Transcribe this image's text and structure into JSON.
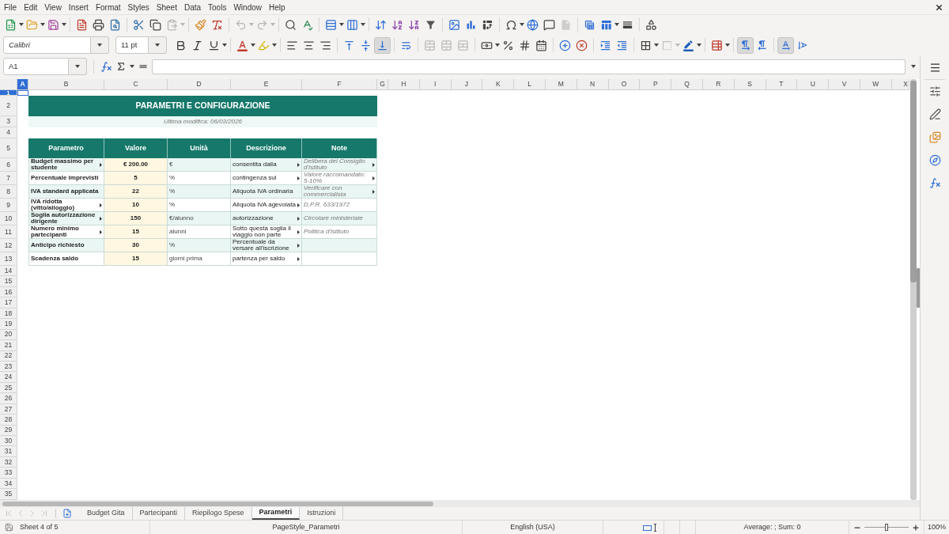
{
  "menu": [
    "File",
    "Edit",
    "View",
    "Insert",
    "Format",
    "Styles",
    "Sheet",
    "Data",
    "Tools",
    "Window",
    "Help"
  ],
  "standard_toolbar": [
    [
      {
        "kind": "new",
        "disabled": false
      },
      {
        "kind": "open",
        "disabled": false
      },
      {
        "kind": "save",
        "disabled": false
      }
    ],
    [
      {
        "kind": "pdf",
        "disabled": false
      },
      {
        "kind": "print",
        "disabled": false
      },
      {
        "kind": "preview",
        "disabled": false
      }
    ],
    [
      {
        "kind": "cut",
        "disabled": false
      },
      {
        "kind": "copy",
        "disabled": false
      },
      {
        "kind": "paste",
        "disabled": true
      }
    ],
    [
      {
        "kind": "clone",
        "disabled": false
      },
      {
        "kind": "clear",
        "disabled": false
      }
    ],
    [
      {
        "kind": "undo",
        "disabled": true
      },
      {
        "kind": "redo",
        "disabled": true
      }
    ],
    [
      {
        "kind": "find",
        "disabled": false
      },
      {
        "kind": "spelling",
        "disabled": false
      }
    ],
    [
      {
        "kind": "rows",
        "disabled": false
      },
      {
        "kind": "columns",
        "disabled": false
      }
    ],
    [
      {
        "kind": "sort",
        "disabled": false
      },
      {
        "kind": "ascending",
        "disabled": false
      },
      {
        "kind": "descending",
        "disabled": false
      },
      {
        "kind": "filter",
        "disabled": false
      }
    ],
    [
      {
        "kind": "image",
        "disabled": false
      },
      {
        "kind": "chart",
        "disabled": false
      },
      {
        "kind": "pivot",
        "disabled": false
      }
    ],
    [
      {
        "kind": "special",
        "disabled": false
      },
      {
        "kind": "hyperlink",
        "disabled": false
      },
      {
        "kind": "comment",
        "disabled": false
      },
      {
        "kind": "header",
        "disabled": true
      }
    ],
    [
      {
        "kind": "printarea",
        "disabled": false
      },
      {
        "kind": "freeze",
        "disabled": false
      },
      {
        "kind": "split",
        "disabled": false
      }
    ],
    [
      {
        "kind": "draw",
        "disabled": false
      }
    ]
  ],
  "formatting_toolbar": {
    "font_name": "Calibri",
    "font_size": "11 pt",
    "groups": [
      [
        {
          "kind": "bold",
          "disabled": false,
          "selected": false
        },
        {
          "kind": "italic",
          "disabled": false,
          "selected": false
        },
        {
          "kind": "underline",
          "disabled": false,
          "selected": false
        }
      ],
      [
        {
          "kind": "fontcolor",
          "disabled": false,
          "selected": false
        },
        {
          "kind": "highlight",
          "disabled": false,
          "selected": false
        }
      ],
      [
        {
          "kind": "left",
          "disabled": false,
          "selected": false
        },
        {
          "kind": "center",
          "disabled": false,
          "selected": false
        },
        {
          "kind": "right",
          "disabled": false,
          "selected": false
        }
      ],
      [
        {
          "kind": "top",
          "disabled": false,
          "selected": false
        },
        {
          "kind": "middle",
          "disabled": false,
          "selected": false
        },
        {
          "kind": "bottom",
          "disabled": false,
          "selected": true
        }
      ],
      [
        {
          "kind": "wrap",
          "disabled": false,
          "selected": false
        }
      ],
      [
        {
          "kind": "mergecenter",
          "disabled": true,
          "selected": false
        },
        {
          "kind": "merge",
          "disabled": true,
          "selected": false
        },
        {
          "kind": "unmerge",
          "disabled": true,
          "selected": false
        }
      ],
      [
        {
          "kind": "currency",
          "disabled": false,
          "selected": false
        },
        {
          "kind": "percent",
          "disabled": false,
          "selected": false
        },
        {
          "kind": "number",
          "disabled": false,
          "selected": false
        },
        {
          "kind": "date",
          "disabled": false,
          "selected": false
        }
      ],
      [
        {
          "kind": "adddecimal",
          "disabled": false,
          "selected": false
        },
        {
          "kind": "deldecimal",
          "disabled": false,
          "selected": false
        }
      ],
      [
        {
          "kind": "indent",
          "disabled": false,
          "selected": false
        },
        {
          "kind": "outdent",
          "disabled": false,
          "selected": false
        }
      ],
      [
        {
          "kind": "borders",
          "disabled": false,
          "selected": false
        },
        {
          "kind": "borderstyle",
          "disabled": true,
          "selected": false
        },
        {
          "kind": "bordercolor",
          "disabled": false,
          "selected": false
        }
      ],
      [
        {
          "kind": "conditional",
          "disabled": false,
          "selected": false
        }
      ],
      [
        {
          "kind": "ltr",
          "disabled": false,
          "selected": true
        },
        {
          "kind": "rtl",
          "disabled": false,
          "selected": false
        }
      ],
      [
        {
          "kind": "horizontal",
          "disabled": false,
          "selected": true
        },
        {
          "kind": "vertical",
          "disabled": false,
          "selected": false
        }
      ]
    ]
  },
  "formula_bar": {
    "cell_reference": "A1"
  },
  "column_headers": [
    {
      "label": "A",
      "selected": true
    },
    {
      "label": "B",
      "selected": false
    },
    {
      "label": "C",
      "selected": false
    },
    {
      "label": "D",
      "selected": false
    },
    {
      "label": "E",
      "selected": false
    },
    {
      "label": "F",
      "selected": false
    },
    {
      "label": "G",
      "selected": false
    },
    {
      "label": "H",
      "selected": false
    },
    {
      "label": "I",
      "selected": false
    },
    {
      "label": "J",
      "selected": false
    },
    {
      "label": "K",
      "selected": false
    },
    {
      "label": "L",
      "selected": false
    },
    {
      "label": "M",
      "selected": false
    },
    {
      "label": "N",
      "selected": false
    },
    {
      "label": "O",
      "selected": false
    },
    {
      "label": "P",
      "selected": false
    },
    {
      "label": "Q",
      "selected": false
    },
    {
      "label": "R",
      "selected": false
    },
    {
      "label": "S",
      "selected": false
    },
    {
      "label": "T",
      "selected": false
    },
    {
      "label": "U",
      "selected": false
    },
    {
      "label": "V",
      "selected": false
    },
    {
      "label": "W",
      "selected": false
    },
    {
      "label": "X",
      "selected": false
    }
  ],
  "row_headers": [
    {
      "label": "1",
      "selected": true
    },
    {
      "label": "2",
      "selected": false
    },
    {
      "label": "3",
      "selected": false
    },
    {
      "label": "4",
      "selected": false
    },
    {
      "label": "5",
      "selected": false
    },
    {
      "label": "6",
      "selected": false
    },
    {
      "label": "7",
      "selected": false
    },
    {
      "label": "8",
      "selected": false
    },
    {
      "label": "9",
      "selected": false
    },
    {
      "label": "10",
      "selected": false
    },
    {
      "label": "11",
      "selected": false
    },
    {
      "label": "12",
      "selected": false
    },
    {
      "label": "13",
      "selected": false
    },
    {
      "label": "14",
      "selected": false
    },
    {
      "label": "15",
      "selected": false
    },
    {
      "label": "16",
      "selected": false
    },
    {
      "label": "17",
      "selected": false
    },
    {
      "label": "18",
      "selected": false
    },
    {
      "label": "19",
      "selected": false
    },
    {
      "label": "20",
      "selected": false
    },
    {
      "label": "21",
      "selected": false
    },
    {
      "label": "22",
      "selected": false
    },
    {
      "label": "23",
      "selected": false
    },
    {
      "label": "24",
      "selected": false
    },
    {
      "label": "25",
      "selected": false
    },
    {
      "label": "26",
      "selected": false
    },
    {
      "label": "27",
      "selected": false
    },
    {
      "label": "28",
      "selected": false
    },
    {
      "label": "29",
      "selected": false
    },
    {
      "label": "30",
      "selected": false
    },
    {
      "label": "31",
      "selected": false
    },
    {
      "label": "32",
      "selected": false
    },
    {
      "label": "33",
      "selected": false
    },
    {
      "label": "34",
      "selected": false
    },
    {
      "label": "35",
      "selected": false
    }
  ],
  "sheet": {
    "title": "PARAMETRI E CONFIGURAZIONE",
    "last_modified": "Ultima modifica: 06/03/2026",
    "table": {
      "columns": [
        "Parametro",
        "Valore",
        "Unità",
        "Descrizione",
        "Note"
      ],
      "rows": [
        {
          "cells": [
            {
              "text": "Budget massimo per studente",
              "overflow": true
            },
            {
              "text": "€ 200.00",
              "overflow": false
            },
            {
              "text": "€",
              "overflow": false
            },
            {
              "text": "consentita dalla",
              "overflow": true
            },
            {
              "text": "Delibera del Consiglio d'Istituto",
              "overflow": true
            }
          ]
        },
        {
          "cells": [
            {
              "text": "Percentuale imprevisti",
              "overflow": false
            },
            {
              "text": "5",
              "overflow": false
            },
            {
              "text": "%",
              "overflow": false
            },
            {
              "text": "contingenza sul",
              "overflow": true
            },
            {
              "text": "Valore raccomandato: 5-10%",
              "overflow": true
            }
          ]
        },
        {
          "cells": [
            {
              "text": "IVA standard applicata",
              "overflow": false
            },
            {
              "text": "22",
              "overflow": false
            },
            {
              "text": "%",
              "overflow": false
            },
            {
              "text": "Aliquota IVA ordinaria",
              "overflow": false
            },
            {
              "text": "Verificare con commercialista",
              "overflow": true
            }
          ]
        },
        {
          "cells": [
            {
              "text": "IVA ridotta (vitto/alloggio)",
              "overflow": true
            },
            {
              "text": "10",
              "overflow": false
            },
            {
              "text": "%",
              "overflow": false
            },
            {
              "text": "Aliquota IVA agevolata",
              "overflow": true
            },
            {
              "text": "D.P.R. 633/1972",
              "overflow": false
            }
          ]
        },
        {
          "cells": [
            {
              "text": "Soglia autorizzazione dirigente",
              "overflow": true
            },
            {
              "text": "150",
              "overflow": false
            },
            {
              "text": "€/alunno",
              "overflow": false
            },
            {
              "text": "autorizzazione",
              "overflow": true
            },
            {
              "text": "Circolare ministeriale",
              "overflow": false
            }
          ]
        },
        {
          "cells": [
            {
              "text": "Numero minimo partecipanti",
              "overflow": true
            },
            {
              "text": "15",
              "overflow": false
            },
            {
              "text": "alunni",
              "overflow": false
            },
            {
              "text": "Sotto questa soglia il viaggio non parte",
              "overflow": true
            },
            {
              "text": "Politica d'istituto",
              "overflow": false
            }
          ]
        },
        {
          "cells": [
            {
              "text": "Anticipo richiesto",
              "overflow": false
            },
            {
              "text": "30",
              "overflow": false
            },
            {
              "text": "%",
              "overflow": false
            },
            {
              "text": "Percentuale da versare all'iscrizione",
              "overflow": true
            },
            {
              "overflow": false
            }
          ]
        },
        {
          "cells": [
            {
              "text": "Scadenza saldo",
              "overflow": false
            },
            {
              "text": "15",
              "overflow": false
            },
            {
              "text": "giorni prima",
              "overflow": false
            },
            {
              "text": "partenza per saldo",
              "overflow": true
            },
            {
              "overflow": false
            }
          ]
        }
      ]
    }
  },
  "sheet_nav": {
    "disabled": true
  },
  "sheet_tabs": [
    {
      "label": "Budget Gita",
      "selected": false
    },
    {
      "label": "Partecipanti",
      "selected": false
    },
    {
      "label": "Riepilogo Spese",
      "selected": false
    },
    {
      "label": "Parametri",
      "selected": true
    },
    {
      "label": "Istruzioni",
      "selected": false
    }
  ],
  "status_bar": {
    "sheet": "Sheet 4 of 5",
    "page_style": "PageStyle_Parametri",
    "language": "English (USA)",
    "selection_summary": "Average: ; Sum: 0",
    "zoom": {
      "level": 0.5,
      "reading": "100%"
    }
  }
}
